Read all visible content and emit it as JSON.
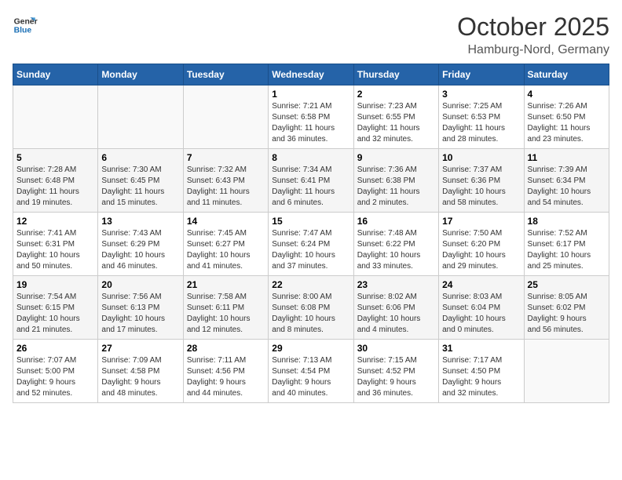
{
  "logo": {
    "line1": "General",
    "line2": "Blue"
  },
  "title": "October 2025",
  "location": "Hamburg-Nord, Germany",
  "days_of_week": [
    "Sunday",
    "Monday",
    "Tuesday",
    "Wednesday",
    "Thursday",
    "Friday",
    "Saturday"
  ],
  "weeks": [
    [
      {
        "day": "",
        "info": ""
      },
      {
        "day": "",
        "info": ""
      },
      {
        "day": "",
        "info": ""
      },
      {
        "day": "1",
        "info": "Sunrise: 7:21 AM\nSunset: 6:58 PM\nDaylight: 11 hours\nand 36 minutes."
      },
      {
        "day": "2",
        "info": "Sunrise: 7:23 AM\nSunset: 6:55 PM\nDaylight: 11 hours\nand 32 minutes."
      },
      {
        "day": "3",
        "info": "Sunrise: 7:25 AM\nSunset: 6:53 PM\nDaylight: 11 hours\nand 28 minutes."
      },
      {
        "day": "4",
        "info": "Sunrise: 7:26 AM\nSunset: 6:50 PM\nDaylight: 11 hours\nand 23 minutes."
      }
    ],
    [
      {
        "day": "5",
        "info": "Sunrise: 7:28 AM\nSunset: 6:48 PM\nDaylight: 11 hours\nand 19 minutes."
      },
      {
        "day": "6",
        "info": "Sunrise: 7:30 AM\nSunset: 6:45 PM\nDaylight: 11 hours\nand 15 minutes."
      },
      {
        "day": "7",
        "info": "Sunrise: 7:32 AM\nSunset: 6:43 PM\nDaylight: 11 hours\nand 11 minutes."
      },
      {
        "day": "8",
        "info": "Sunrise: 7:34 AM\nSunset: 6:41 PM\nDaylight: 11 hours\nand 6 minutes."
      },
      {
        "day": "9",
        "info": "Sunrise: 7:36 AM\nSunset: 6:38 PM\nDaylight: 11 hours\nand 2 minutes."
      },
      {
        "day": "10",
        "info": "Sunrise: 7:37 AM\nSunset: 6:36 PM\nDaylight: 10 hours\nand 58 minutes."
      },
      {
        "day": "11",
        "info": "Sunrise: 7:39 AM\nSunset: 6:34 PM\nDaylight: 10 hours\nand 54 minutes."
      }
    ],
    [
      {
        "day": "12",
        "info": "Sunrise: 7:41 AM\nSunset: 6:31 PM\nDaylight: 10 hours\nand 50 minutes."
      },
      {
        "day": "13",
        "info": "Sunrise: 7:43 AM\nSunset: 6:29 PM\nDaylight: 10 hours\nand 46 minutes."
      },
      {
        "day": "14",
        "info": "Sunrise: 7:45 AM\nSunset: 6:27 PM\nDaylight: 10 hours\nand 41 minutes."
      },
      {
        "day": "15",
        "info": "Sunrise: 7:47 AM\nSunset: 6:24 PM\nDaylight: 10 hours\nand 37 minutes."
      },
      {
        "day": "16",
        "info": "Sunrise: 7:48 AM\nSunset: 6:22 PM\nDaylight: 10 hours\nand 33 minutes."
      },
      {
        "day": "17",
        "info": "Sunrise: 7:50 AM\nSunset: 6:20 PM\nDaylight: 10 hours\nand 29 minutes."
      },
      {
        "day": "18",
        "info": "Sunrise: 7:52 AM\nSunset: 6:17 PM\nDaylight: 10 hours\nand 25 minutes."
      }
    ],
    [
      {
        "day": "19",
        "info": "Sunrise: 7:54 AM\nSunset: 6:15 PM\nDaylight: 10 hours\nand 21 minutes."
      },
      {
        "day": "20",
        "info": "Sunrise: 7:56 AM\nSunset: 6:13 PM\nDaylight: 10 hours\nand 17 minutes."
      },
      {
        "day": "21",
        "info": "Sunrise: 7:58 AM\nSunset: 6:11 PM\nDaylight: 10 hours\nand 12 minutes."
      },
      {
        "day": "22",
        "info": "Sunrise: 8:00 AM\nSunset: 6:08 PM\nDaylight: 10 hours\nand 8 minutes."
      },
      {
        "day": "23",
        "info": "Sunrise: 8:02 AM\nSunset: 6:06 PM\nDaylight: 10 hours\nand 4 minutes."
      },
      {
        "day": "24",
        "info": "Sunrise: 8:03 AM\nSunset: 6:04 PM\nDaylight: 10 hours\nand 0 minutes."
      },
      {
        "day": "25",
        "info": "Sunrise: 8:05 AM\nSunset: 6:02 PM\nDaylight: 9 hours\nand 56 minutes."
      }
    ],
    [
      {
        "day": "26",
        "info": "Sunrise: 7:07 AM\nSunset: 5:00 PM\nDaylight: 9 hours\nand 52 minutes."
      },
      {
        "day": "27",
        "info": "Sunrise: 7:09 AM\nSunset: 4:58 PM\nDaylight: 9 hours\nand 48 minutes."
      },
      {
        "day": "28",
        "info": "Sunrise: 7:11 AM\nSunset: 4:56 PM\nDaylight: 9 hours\nand 44 minutes."
      },
      {
        "day": "29",
        "info": "Sunrise: 7:13 AM\nSunset: 4:54 PM\nDaylight: 9 hours\nand 40 minutes."
      },
      {
        "day": "30",
        "info": "Sunrise: 7:15 AM\nSunset: 4:52 PM\nDaylight: 9 hours\nand 36 minutes."
      },
      {
        "day": "31",
        "info": "Sunrise: 7:17 AM\nSunset: 4:50 PM\nDaylight: 9 hours\nand 32 minutes."
      },
      {
        "day": "",
        "info": ""
      }
    ]
  ]
}
